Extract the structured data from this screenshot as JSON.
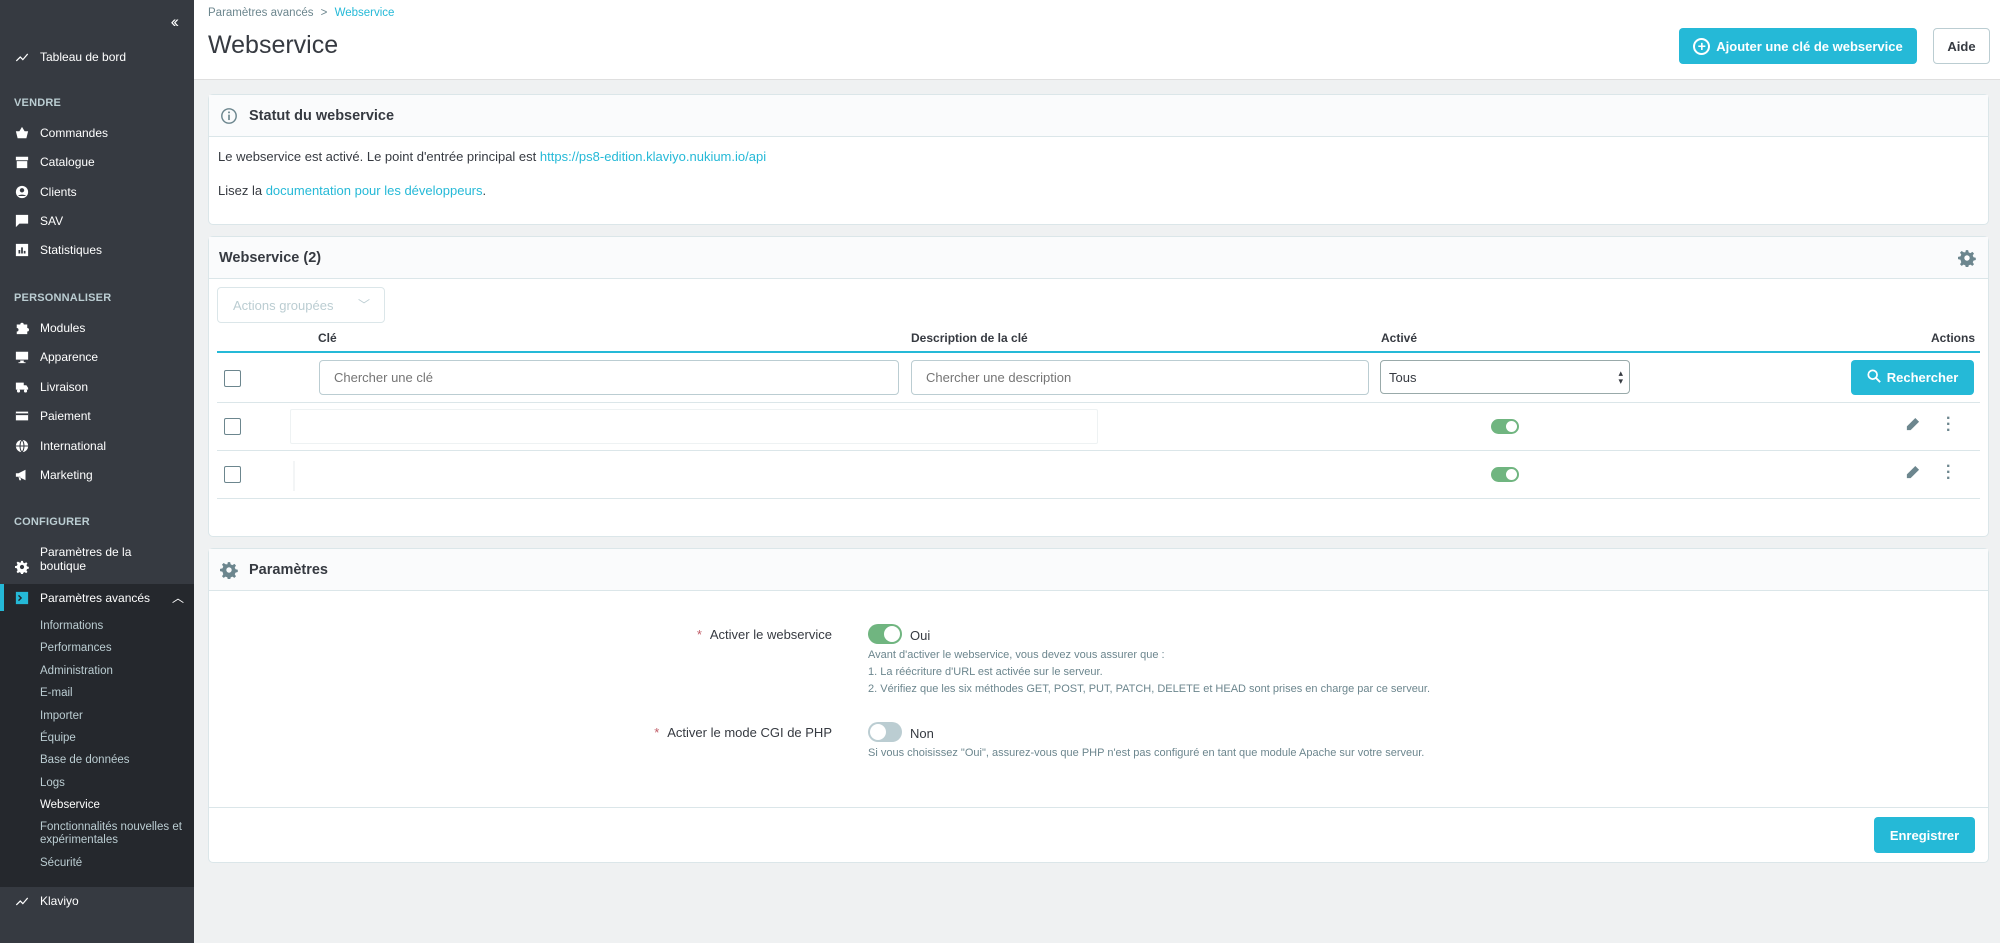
{
  "sidebar": {
    "collapse_icon": "double-chevron-left-icon",
    "dashboard": "Tableau de bord",
    "sections": {
      "sell": "VENDRE",
      "customize": "PERSONNALISER",
      "configure": "CONFIGURER"
    },
    "sell_items": [
      "Commandes",
      "Catalogue",
      "Clients",
      "SAV",
      "Statistiques"
    ],
    "customize_items": [
      "Modules",
      "Apparence",
      "Livraison",
      "Paiement",
      "International",
      "Marketing"
    ],
    "shop_params": "Paramètres de la boutique",
    "advanced_params": "Paramètres avancés",
    "advanced_sub": [
      "Informations",
      "Performances",
      "Administration",
      "E-mail",
      "Importer",
      "Équipe",
      "Base de données",
      "Logs",
      "Webservice",
      "Fonctionnalités nouvelles et expérimentales",
      "Sécurité"
    ],
    "klaviyo": "Klaviyo"
  },
  "header": {
    "breadcrumb_parent": "Paramètres avancés",
    "breadcrumb_sep": ">",
    "breadcrumb_current": "Webservice",
    "title": "Webservice",
    "add_key_button": "Ajouter une clé de webservice",
    "help_button": "Aide"
  },
  "status_card": {
    "title": "Statut du webservice",
    "line1_prefix": "Le webservice est activé. Le point d'entrée principal est",
    "line1_link": "https://ps8-edition.klaviyo.nukium.io/api",
    "line2_prefix": "Lisez la",
    "line2_link": "documentation pour les développeurs",
    "line2_suffix": "."
  },
  "list_card": {
    "title": "Webservice (2)",
    "bulk_actions": "Actions groupées",
    "columns": {
      "key": "Clé",
      "description": "Description de la clé",
      "active": "Activé",
      "actions": "Actions"
    },
    "filter_key_placeholder": "Chercher une clé",
    "filter_desc_placeholder": "Chercher une description",
    "filter_active_value": "Tous",
    "search_button": "Rechercher",
    "rows": [
      {
        "active": true
      },
      {
        "active": true
      }
    ]
  },
  "params_card": {
    "title": "Paramètres",
    "field1_label": "Activer le webservice",
    "field1_value": "Oui",
    "field1_help": [
      "Avant d'activer le webservice, vous devez vous assurer que :",
      "1. La réécriture d'URL est activée sur le serveur.",
      "2. Vérifiez que les six méthodes GET, POST, PUT, PATCH, DELETE et HEAD sont prises en charge par ce serveur."
    ],
    "field2_label": "Activer le mode CGI de PHP",
    "field2_value": "Non",
    "field2_help": "Si vous choisissez \"Oui\", assurez-vous que PHP n'est pas configuré en tant que module Apache sur votre serveur.",
    "save_button": "Enregistrer"
  },
  "colors": {
    "accent": "#25b9d7",
    "sidebar": "#363a41",
    "toggle_on": "#70b580",
    "toggle_off": "#bbcdd2"
  }
}
